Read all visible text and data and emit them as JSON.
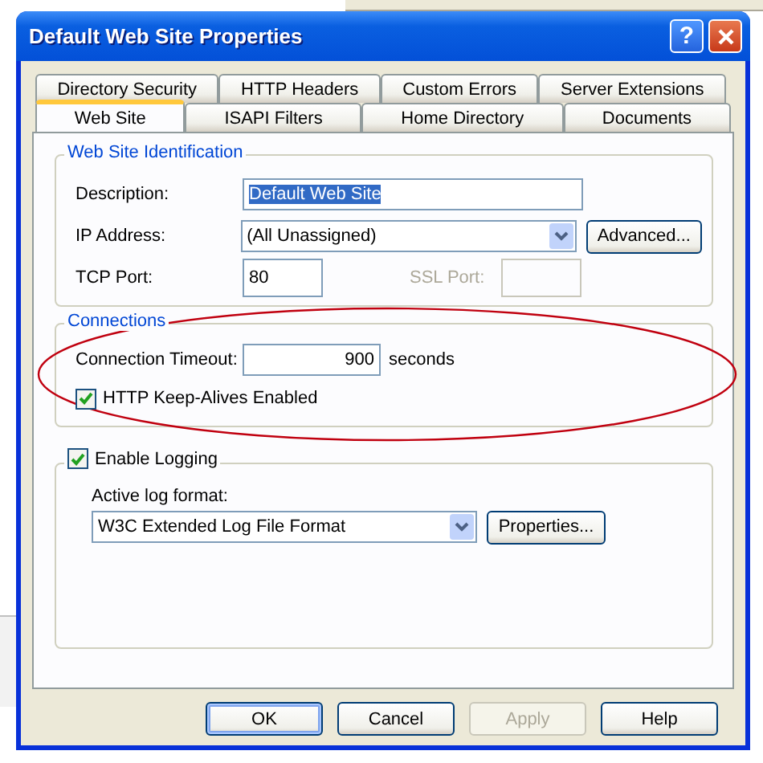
{
  "window": {
    "title": "Default Web Site Properties",
    "title_buttons": [
      {
        "kind": "help",
        "label": "?"
      },
      {
        "kind": "close"
      }
    ]
  },
  "tab_rows": [
    [
      {
        "label": "Directory Security",
        "selected": false
      },
      {
        "label": "HTTP Headers",
        "selected": false
      },
      {
        "label": "Custom Errors",
        "selected": false
      },
      {
        "label": "Server Extensions",
        "selected": false
      }
    ],
    [
      {
        "label": "Web Site",
        "selected": true
      },
      {
        "label": "ISAPI Filters",
        "selected": false
      },
      {
        "label": "Home Directory",
        "selected": false
      },
      {
        "label": "Documents",
        "selected": false
      }
    ]
  ],
  "identification": {
    "title": "Web Site Identification",
    "description": {
      "label": "Description:",
      "value": "Default Web Site",
      "selected": true
    },
    "ip_address": {
      "label": "IP Address:",
      "value": "(All Unassigned)",
      "button": "Advanced..."
    },
    "tcp_port": {
      "label": "TCP Port:",
      "value": "80"
    },
    "ssl_port": {
      "label": "SSL Port:",
      "disabled": true
    }
  },
  "connections": {
    "title": "Connections",
    "timeout": {
      "label": "Connection Timeout:",
      "value": "900",
      "unit": "seconds"
    },
    "keep_alives": {
      "label": "HTTP Keep-Alives Enabled",
      "checked": true
    }
  },
  "logging": {
    "label": "Enable Logging",
    "checked": true,
    "format_label": "Active log format:",
    "format": "W3C Extended Log File Format",
    "button": "Properties..."
  },
  "annotation": {
    "kind": "ellipse",
    "color": "#c0000f"
  },
  "buttons": [
    {
      "label": "OK",
      "default": true,
      "disabled": false
    },
    {
      "label": "Cancel",
      "default": false,
      "disabled": false
    },
    {
      "label": "Apply",
      "default": false,
      "disabled": true
    },
    {
      "label": "Help",
      "default": false,
      "disabled": false
    }
  ]
}
